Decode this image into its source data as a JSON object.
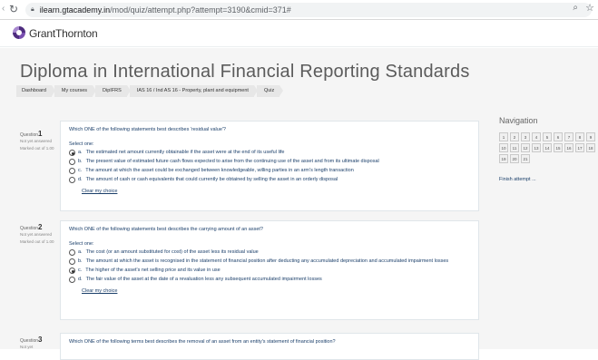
{
  "browser": {
    "url_host": "ilearn.gtacademy.in",
    "url_path": "/mod/quiz/attempt.php?attempt=3190&cmid=371#"
  },
  "site": {
    "logo_text": "GrantThornton"
  },
  "page": {
    "title": "Diploma in International Financial Reporting Standards"
  },
  "breadcrumb": [
    "Dashboard",
    "My courses",
    "DipIFRS",
    "IAS 16 / Ind AS 16 - Property, plant and equipment",
    "Quiz"
  ],
  "questions": [
    {
      "label": "Question",
      "number": "1",
      "state": "Not yet answered",
      "mark": "Marked out of 1.00",
      "text": "Which ONE of the following statements best describes 'residual value'?",
      "select_one": "Select one:",
      "options": [
        {
          "letter": "a.",
          "text": "The estimated net amount currently obtainable if the asset were at the end of its useful life",
          "selected": true
        },
        {
          "letter": "b.",
          "text": "The present value of estimated future cash flows expected to arise from the continuing use of the asset and from its ultimate disposal",
          "selected": false
        },
        {
          "letter": "c.",
          "text": "The amount at which the asset could be exchanged between knowledgeable, willing parties in an arm's length transaction",
          "selected": false
        },
        {
          "letter": "d.",
          "text": "The amount of cash or cash equivalents that could currently be obtained by selling the asset in an orderly disposal",
          "selected": false
        }
      ],
      "clear": "Clear my choice"
    },
    {
      "label": "Question",
      "number": "2",
      "state": "Not yet answered",
      "mark": "Marked out of 1.00",
      "text": "Which ONE of the following statements best describes the carrying amount of an asset?",
      "select_one": "Select one:",
      "options": [
        {
          "letter": "a.",
          "text": "The cost (or an amount substituted for cost) of the asset less its residual value",
          "selected": false
        },
        {
          "letter": "b.",
          "text": "The amount at which the asset is recognised in the statement of financial position after deducting any accumulated depreciation and accumulated impairment losses",
          "selected": false
        },
        {
          "letter": "c.",
          "text": "The higher of the asset's net selling price and its value in use",
          "selected": true
        },
        {
          "letter": "d.",
          "text": "The fair value of the asset at the date of a revaluation less any subsequent accumulated impairment losses",
          "selected": false
        }
      ],
      "clear": "Clear my choice"
    },
    {
      "label": "Question",
      "number": "3",
      "state": "Not yet",
      "text": "Which ONE of the following terms best describes the removal of an asset from an entity's statement of financial position?"
    }
  ],
  "navigation": {
    "title": "Navigation",
    "buttons": [
      "1",
      "2",
      "3",
      "4",
      "5",
      "6",
      "7",
      "8",
      "9",
      "10",
      "11",
      "12",
      "13",
      "14",
      "15",
      "16",
      "17",
      "18",
      "19",
      "20",
      "21"
    ],
    "finish": "Finish attempt ..."
  },
  "colors": {
    "accent": "#4f2d7f",
    "link": "#1b3f6a",
    "background": "#f5f5f5"
  }
}
